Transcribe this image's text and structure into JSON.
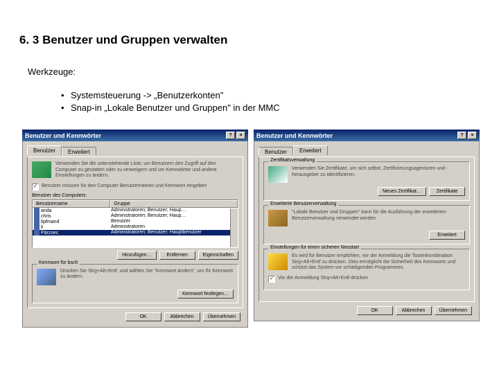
{
  "heading": "6. 3   Benutzer und Gruppen verwalten",
  "tools_label": "Werkzeuge:",
  "bullets": [
    "Systemsteuerung -> „Benutzerkonten\"",
    "Snap-in „Lokale Benutzer und Gruppen\" in der MMC"
  ],
  "dialog_title": "Benutzer und Kennwörter",
  "win_help": "?",
  "win_close": "×",
  "left": {
    "tab1": "Benutzer",
    "tab2": "Erweitert",
    "intro": "Verwenden Sie die untenstehende Liste, um Benutzern den Zugriff auf den Computer zu gestatten oder zu verweigern und um Kennwörter und andere Einstellungen zu ändern.",
    "chk_mark": "✓",
    "chk_label": "Benutzer müssen für den Computer Benutzernamen und Kennwort eingeben",
    "group_label": "Benutzer des Computers:",
    "col1": "Benutzername",
    "col2": "Gruppe",
    "rows": [
      {
        "name": "anda",
        "group": "Administratoren; Benutzer; Haup…"
      },
      {
        "name": "chris",
        "group": "Administratoren; Benutzer; Haup…"
      },
      {
        "name": "lipfmand",
        "group": "Benutzer"
      },
      {
        "name": "li",
        "group": "Administratoren"
      },
      {
        "name": "Pärzsec",
        "group": "Administratoren; Benutzer; Hauptbenutzer"
      }
    ],
    "btn_add": "Hinzufügen…",
    "btn_remove": "Entfernen",
    "btn_props": "Eigenschaften",
    "pw_legend": "Kennwort für bsch",
    "pw_text": "Drücken Sie Strg+Alt+Entf, und wählen Sie \"Kennwort ändern\", um Ihr Kennwort zu ändern.",
    "btn_pwset": "Kennwort festlegen…"
  },
  "right": {
    "tab1": "Benutzer",
    "tab2": "Erweitert",
    "cert_legend": "Zertifikatsverwaltung",
    "cert_text": "Verwenden Sie Zertifikate, um sich selbst, Zertifizierungsagenturen und -herausgeber zu identifizieren.",
    "btn_newcert": "Neues Zertifikat…",
    "btn_certs": "Zertifikate",
    "adv_legend": "Erweiterte Benutzerverwaltung",
    "adv_text": "\"Lokale Benutzer und Gruppen\" kann für die Ausführung der erweiterten Benutzerverwaltung verwendet werden.",
    "btn_adv": "Erweitert",
    "secure_legend": "Einstellungen für einen sicheren Neustart",
    "secure_text": "Es wird für Benutzer empfohlen, vor der Anmeldung die Tastenkombination Strg+Alt+Entf zu drücken. Dies ermöglicht die Sicherheit des Kennworts und schützt das System vor schädigenden Programmen.",
    "secure_chk": "Vor der Anmeldung Strg+Alt+Entf drücken"
  },
  "footer": {
    "ok": "OK",
    "cancel": "Abbrechen",
    "apply": "Übernehmen"
  }
}
